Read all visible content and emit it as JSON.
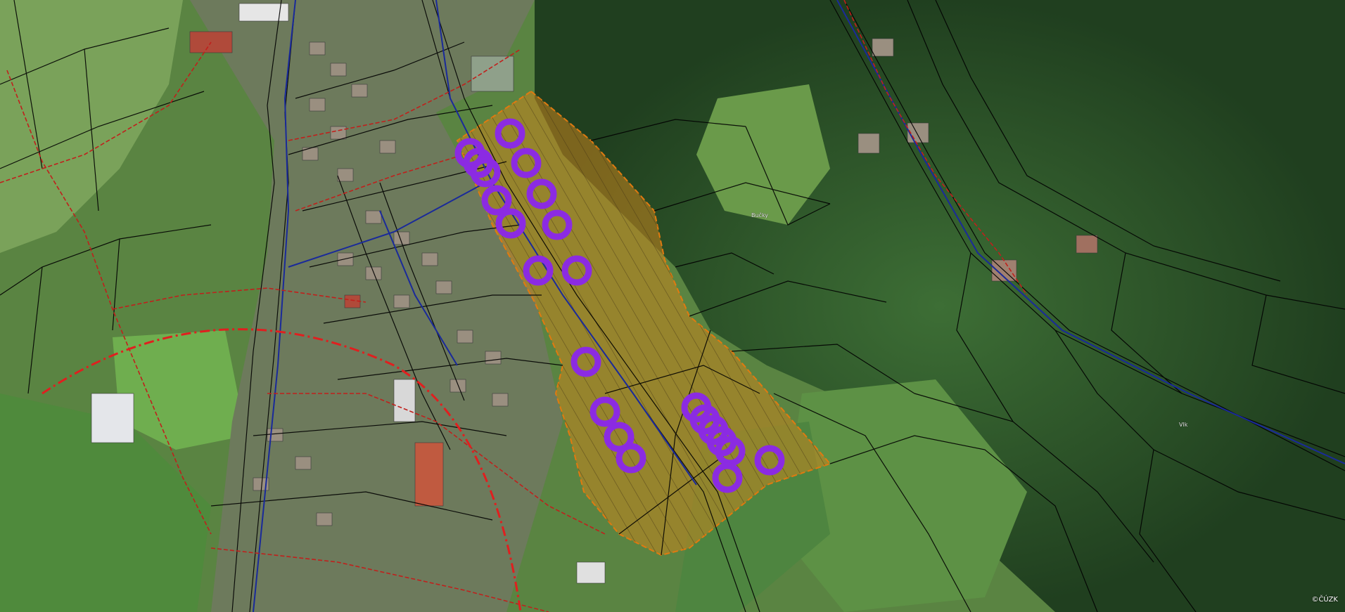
{
  "map": {
    "basemap": "aerial-orthophoto",
    "colors": {
      "meadow": "#5f8a45",
      "meadow_light": "#7fa35b",
      "forest": "#244a23",
      "forest_light": "#3a6b33",
      "village": "#6f7a5e",
      "parcel_lines": "#000000",
      "utility_network": "#c0201c",
      "road_axis": "#1a2a9a",
      "study_area_fill": "#c8851e",
      "study_area_outline": "#e07a10",
      "markers": "#8b2be2"
    },
    "layers": {
      "cadastral_parcels": "parcel-lines",
      "utility_lines": "red-dashed-network",
      "roads": "blue-road-axis",
      "study_area": "orange-hatched-polygon",
      "marker_symbol": "ring-icon"
    },
    "markers_count": 25,
    "labels": {
      "place_1": "Bučky",
      "place_2": "Vlk"
    },
    "copyright": "©ČÚZK"
  }
}
